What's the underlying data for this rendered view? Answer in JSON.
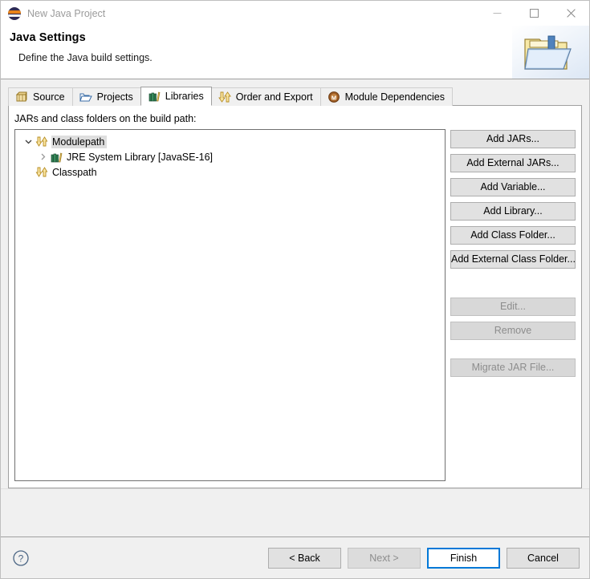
{
  "window": {
    "title": "New Java Project",
    "app_icon": "eclipse-icon",
    "controls": [
      {
        "name": "minimize-button",
        "glyph": "minimize-icon"
      },
      {
        "name": "maximize-button",
        "glyph": "maximize-icon"
      },
      {
        "name": "close-button",
        "glyph": "close-icon"
      }
    ]
  },
  "header": {
    "title": "Java Settings",
    "description": "Define the Java build settings.",
    "banner_icon": "folder-with-down-arrow-icon"
  },
  "tabs": [
    {
      "label": "Source",
      "icon": "source-package-icon",
      "selected": false
    },
    {
      "label": "Projects",
      "icon": "open-folder-icon",
      "selected": false
    },
    {
      "label": "Libraries",
      "icon": "libraries-books-icon",
      "selected": true
    },
    {
      "label": "Order and Export",
      "icon": "order-arrows-icon",
      "selected": false
    },
    {
      "label": "Module Dependencies",
      "icon": "module-m-icon",
      "selected": false
    }
  ],
  "panel": {
    "label": "JARs and class folders on the build path:",
    "tree": [
      {
        "label": "Modulepath",
        "icon": "modulepath-arrows-icon",
        "twisty": "chevron-down-icon",
        "indent": 1,
        "selected": true
      },
      {
        "label": "JRE System Library [JavaSE-16]",
        "icon": "libraries-books-icon",
        "twisty": "chevron-right-icon",
        "indent": 2,
        "selected": false
      },
      {
        "label": "Classpath",
        "icon": "classpath-arrows-icon",
        "twisty": "none",
        "indent": 1,
        "selected": false
      }
    ],
    "buttons": [
      {
        "label": "Add JARs...",
        "name": "add-jars-button",
        "enabled": true,
        "gap": "none"
      },
      {
        "label": "Add External JARs...",
        "name": "add-external-jars-button",
        "enabled": true,
        "gap": "none"
      },
      {
        "label": "Add Variable...",
        "name": "add-variable-button",
        "enabled": true,
        "gap": "none"
      },
      {
        "label": "Add Library...",
        "name": "add-library-button",
        "enabled": true,
        "gap": "none"
      },
      {
        "label": "Add Class Folder...",
        "name": "add-class-folder-button",
        "enabled": true,
        "gap": "none"
      },
      {
        "label": "Add External Class Folder...",
        "name": "add-external-class-folder-button",
        "enabled": true,
        "gap": "none"
      },
      {
        "label": "Edit...",
        "name": "edit-button",
        "enabled": false,
        "gap": "large"
      },
      {
        "label": "Remove",
        "name": "remove-button",
        "enabled": false,
        "gap": "none"
      },
      {
        "label": "Migrate JAR File...",
        "name": "migrate-jar-file-button",
        "enabled": false,
        "gap": "medium"
      }
    ]
  },
  "footer": {
    "help_icon": "help-question-icon",
    "buttons": [
      {
        "label": "< Back",
        "name": "back-button",
        "enabled": true,
        "default": false
      },
      {
        "label": "Next >",
        "name": "next-button",
        "enabled": false,
        "default": false
      },
      {
        "label": "Finish",
        "name": "finish-button",
        "enabled": true,
        "default": true
      },
      {
        "label": "Cancel",
        "name": "cancel-button",
        "enabled": true,
        "default": false
      }
    ]
  },
  "colors": {
    "accent": "#0078d7",
    "dialog_bg": "#f0f0f0",
    "panel_bg": "#ffffff",
    "selection": "#dedede",
    "disabled_text": "#8d8d8d"
  }
}
